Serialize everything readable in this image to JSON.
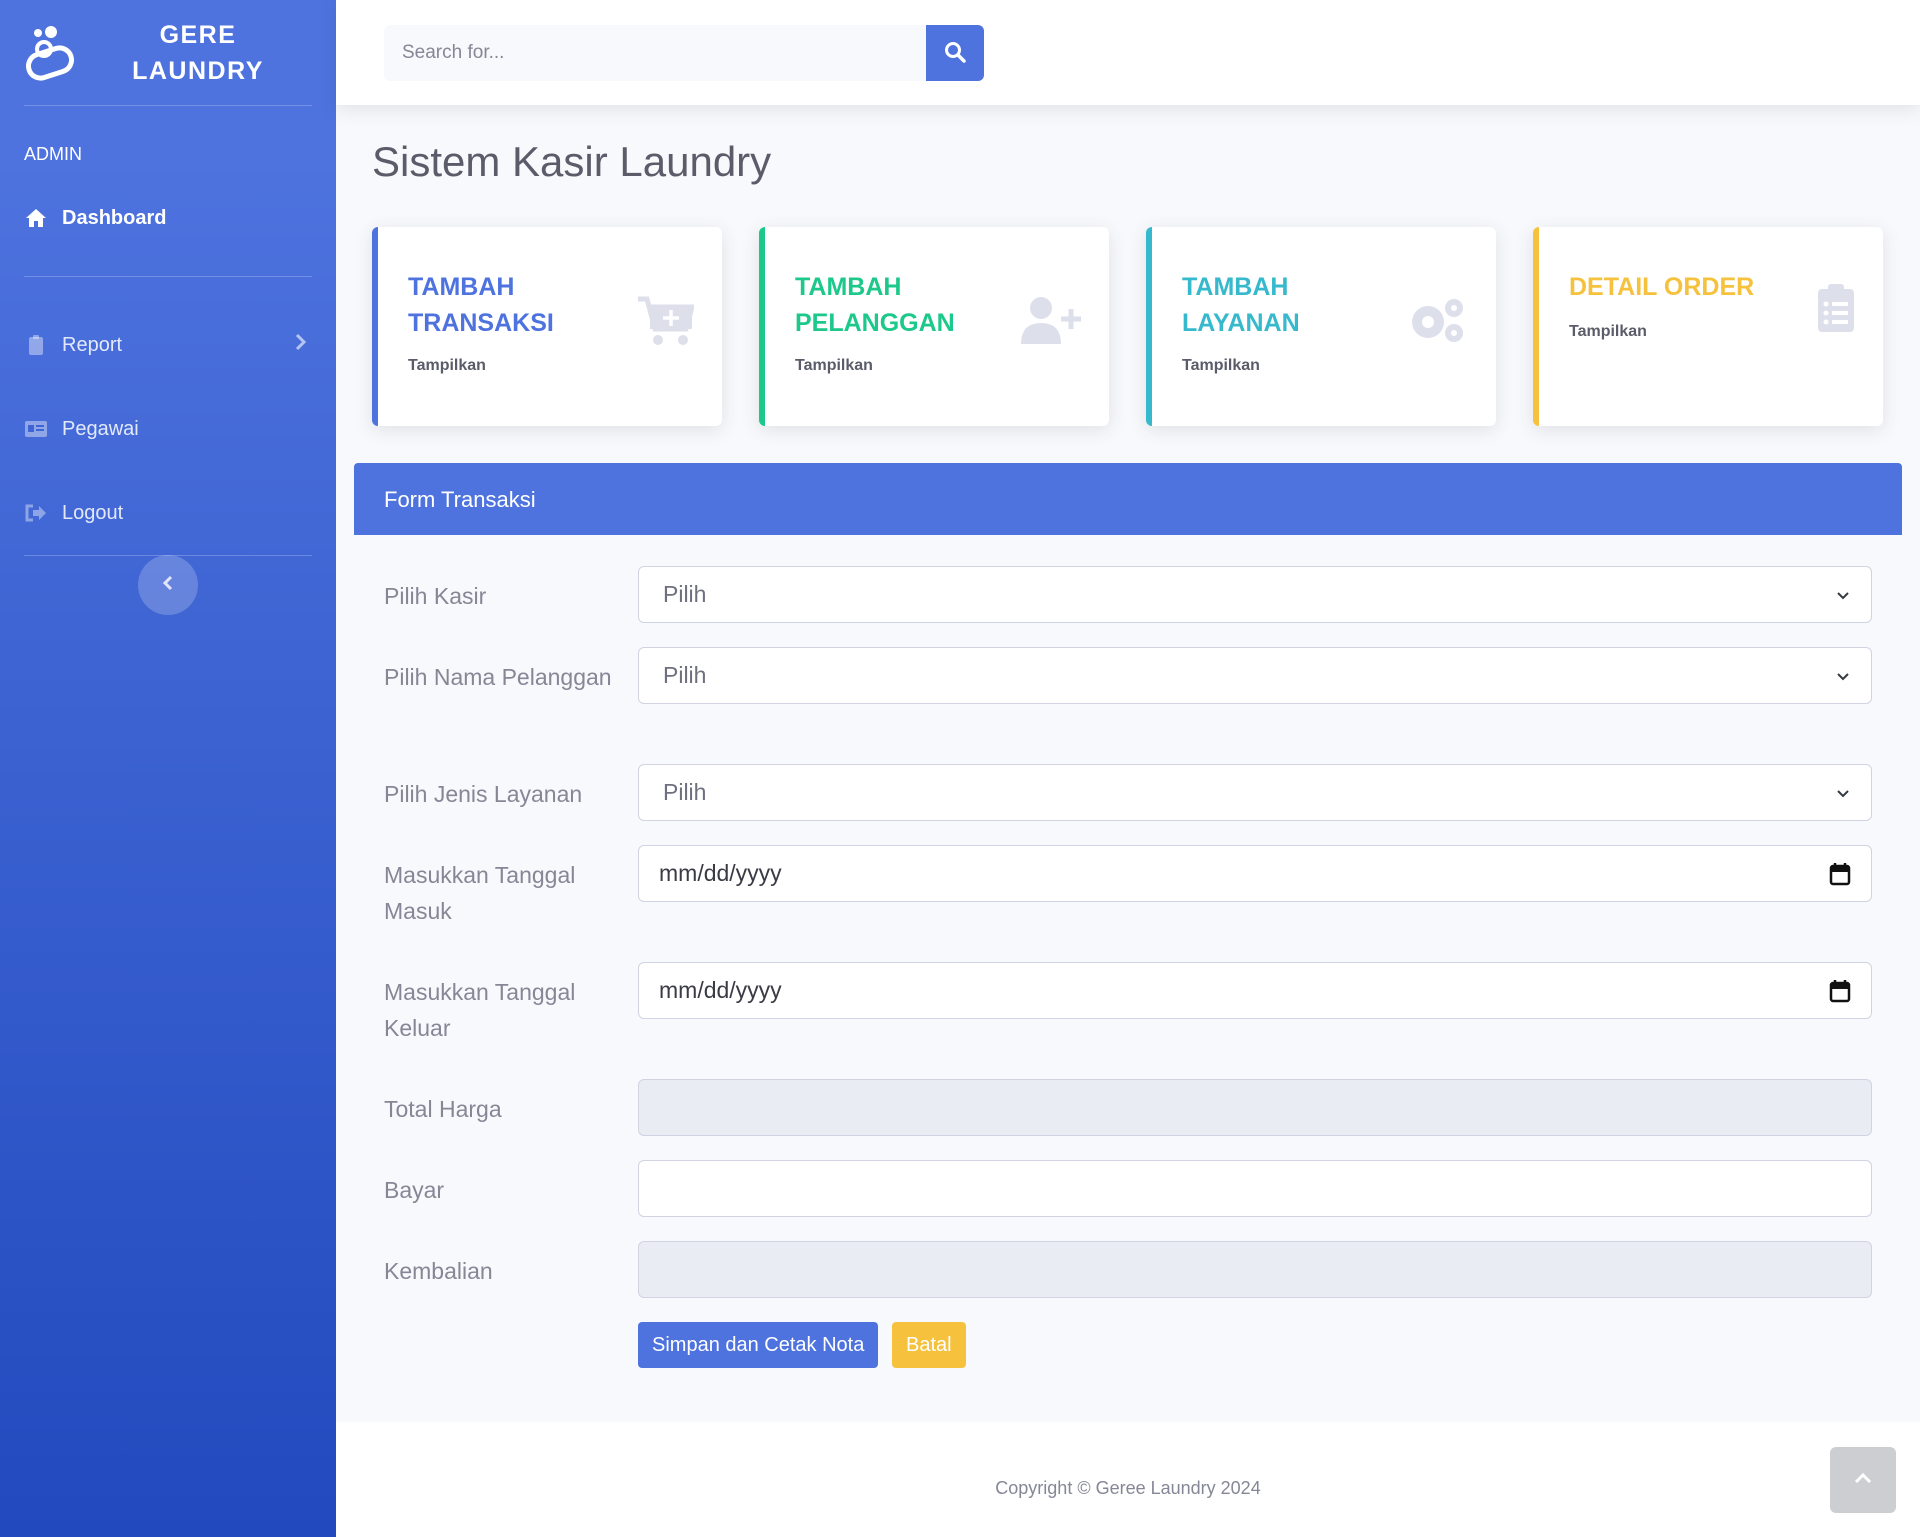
{
  "brand": {
    "name_line1": "GERE",
    "name_line2": "LAUNDRY",
    "icon": "laundry-bubbles-icon"
  },
  "sidebar": {
    "heading": "ADMIN",
    "items": [
      {
        "label": "Dashboard",
        "icon": "home-icon",
        "active": true
      },
      {
        "label": "Report",
        "icon": "clipboard-icon",
        "has_submenu": true
      },
      {
        "label": "Pegawai",
        "icon": "id-card-icon"
      },
      {
        "label": "Logout",
        "icon": "sign-out-icon"
      }
    ],
    "toggle_icon": "chevron-left-icon"
  },
  "topbar": {
    "search_placeholder": "Search for...",
    "search_icon": "search-icon"
  },
  "page": {
    "title": "Sistem Kasir Laundry"
  },
  "cards": [
    {
      "title_line1": "TAMBAH",
      "title_line2": "TRANSAKSI",
      "sub": "Tampilkan",
      "icon": "cart-plus-icon",
      "color": "#4e73df"
    },
    {
      "title_line1": "TAMBAH",
      "title_line2": "PELANGGAN",
      "sub": "Tampilkan",
      "icon": "user-plus-icon",
      "color": "#1cc88a"
    },
    {
      "title_line1": "TAMBAH",
      "title_line2": "LAYANAN",
      "sub": "Tampilkan",
      "icon": "cogs-icon",
      "color": "#36b9cc"
    },
    {
      "title_line1": "DETAIL ORDER",
      "sub": "Tampilkan",
      "icon": "clipboard-list-icon",
      "color": "#f6c23e"
    }
  ],
  "form": {
    "header": "Form Transaksi",
    "fields": [
      {
        "label": "Pilih Kasir",
        "value": "Pilih",
        "type": "select"
      },
      {
        "label": "Pilih Nama Pelanggan",
        "value": "Pilih",
        "type": "select"
      },
      {
        "label": "Pilih Jenis Layanan",
        "value": "Pilih",
        "type": "select"
      },
      {
        "label": "Masukkan Tanggal Masuk",
        "value": "mm/dd/yyyy",
        "type": "date"
      },
      {
        "label": "Masukkan Tanggal Keluar",
        "value": "mm/dd/yyyy",
        "type": "date"
      },
      {
        "label": "Total Harga",
        "value": "",
        "type": "readonly"
      },
      {
        "label": "Bayar",
        "value": "",
        "type": "text"
      },
      {
        "label": "Kembalian",
        "value": "",
        "type": "readonly"
      }
    ],
    "save_button": "Simpan dan Cetak Nota",
    "cancel_button": "Batal"
  },
  "footer": {
    "copyright": "Copyright © Geree Laundry 2024",
    "scroll_top_icon": "angle-up-icon"
  },
  "colors": {
    "primary": "#4e73df",
    "success": "#1cc88a",
    "info": "#36b9cc",
    "warning": "#f6c23e"
  }
}
